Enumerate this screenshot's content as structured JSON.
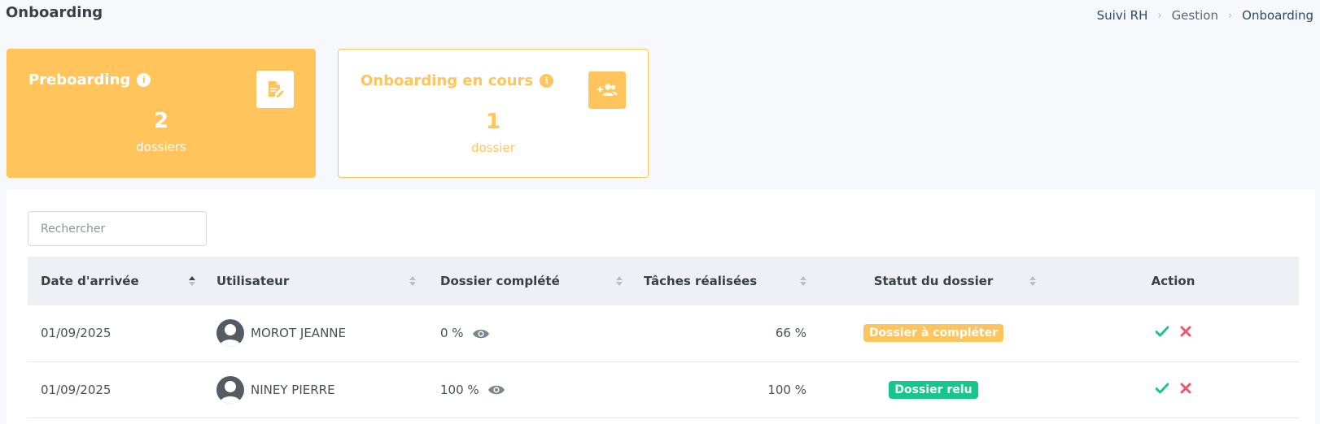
{
  "page": {
    "title": "Onboarding"
  },
  "breadcrumb": {
    "items": [
      "Suivi RH",
      "Gestion",
      "Onboarding"
    ]
  },
  "cards": {
    "preboarding": {
      "title": "Preboarding",
      "count": "2",
      "unit": "dossiers",
      "icon": "file-edit-icon"
    },
    "onboarding": {
      "title": "Onboarding en cours",
      "count": "1",
      "unit": "dossier",
      "icon": "user-add-icon"
    }
  },
  "search": {
    "placeholder": "Rechercher",
    "value": ""
  },
  "table": {
    "columns": [
      "Date d'arrivée",
      "Utilisateur",
      "Dossier complété",
      "Tâches réalisées",
      "Statut du dossier",
      "Action"
    ],
    "rows": [
      {
        "date": "01/09/2025",
        "user": "MOROT JEANNE",
        "dossier": "0 %",
        "taches": "66 %",
        "statut": "Dossier à compléter",
        "statut_color": "#ffc45c"
      },
      {
        "date": "01/09/2025",
        "user": "NINEY PIERRE",
        "dossier": "100 %",
        "taches": "100 %",
        "statut": "Dossier relu",
        "statut_color": "#17c78a"
      }
    ]
  },
  "colors": {
    "accent": "#ffc45c",
    "success": "#17c78a",
    "danger": "#f0566b",
    "link": "#2b4a6b"
  }
}
